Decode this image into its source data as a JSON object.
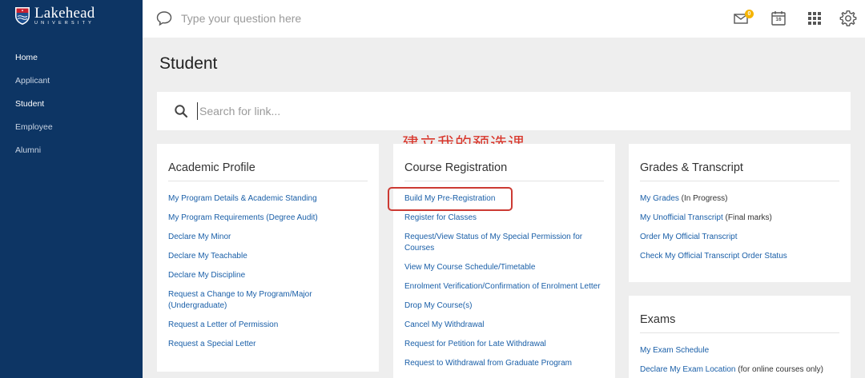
{
  "brand": {
    "name": "Lakehead",
    "sub": "UNIVERSITY"
  },
  "sidebar": {
    "items": [
      {
        "label": "Home",
        "active": true
      },
      {
        "label": "Applicant",
        "active": false
      },
      {
        "label": "Student",
        "active": true
      },
      {
        "label": "Employee",
        "active": false
      },
      {
        "label": "Alumni",
        "active": false
      }
    ]
  },
  "topbar": {
    "question_placeholder": "Type your question here",
    "icons": [
      "chat-icon",
      "mail-icon",
      "calendar-icon",
      "apps-grid-icon",
      "gear-icon"
    ],
    "calendar_day": "16",
    "mail_badge": "0"
  },
  "page": {
    "title": "Student"
  },
  "search": {
    "placeholder": "Search for link..."
  },
  "annotation": {
    "text": "建立我的预选课"
  },
  "cards": {
    "academic": {
      "title": "Academic Profile",
      "links": [
        {
          "text": "My Program Details & Academic Standing"
        },
        {
          "text": "My Program Requirements (Degree Audit)"
        },
        {
          "text": "Declare My Minor"
        },
        {
          "text": "Declare My Teachable"
        },
        {
          "text": "Declare My Discipline"
        },
        {
          "text": "Request a Change to My Program/Major (Undergraduate)"
        },
        {
          "text": "Request a Letter of Permission"
        },
        {
          "text": "Request a Special Letter"
        }
      ]
    },
    "course": {
      "title": "Course Registration",
      "links": [
        {
          "text": "Build My Pre-Registration"
        },
        {
          "text": "Register for Classes"
        },
        {
          "text": "Request/View Status of My Special Permission for Courses"
        },
        {
          "text": "View My Course Schedule/Timetable"
        },
        {
          "text": "Enrolment Verification/Confirmation of Enrolment Letter"
        },
        {
          "text": "Drop My Course(s)"
        },
        {
          "text": "Cancel My Withdrawal"
        },
        {
          "text": "Request for Petition for Late Withdrawal"
        },
        {
          "text": "Request to Withdrawal from Graduate Program"
        }
      ]
    },
    "grades": {
      "title": "Grades & Transcript",
      "links": [
        {
          "text": "My Grades",
          "note": " (In Progress)"
        },
        {
          "text": "My Unofficial Transcript",
          "note": " (Final marks)"
        },
        {
          "text": "Order My Official Transcript"
        },
        {
          "text": "Check My Official Transcript Order Status"
        }
      ]
    },
    "exams": {
      "title": "Exams",
      "links": [
        {
          "text": "My Exam Schedule"
        },
        {
          "text": "Declare My Exam Location",
          "note": " (for online courses only)"
        }
      ]
    }
  },
  "colors": {
    "sidebar_bg": "#0d3564",
    "link": "#1a5fa8",
    "annotation": "#d8352a",
    "badge": "#f5b400"
  }
}
